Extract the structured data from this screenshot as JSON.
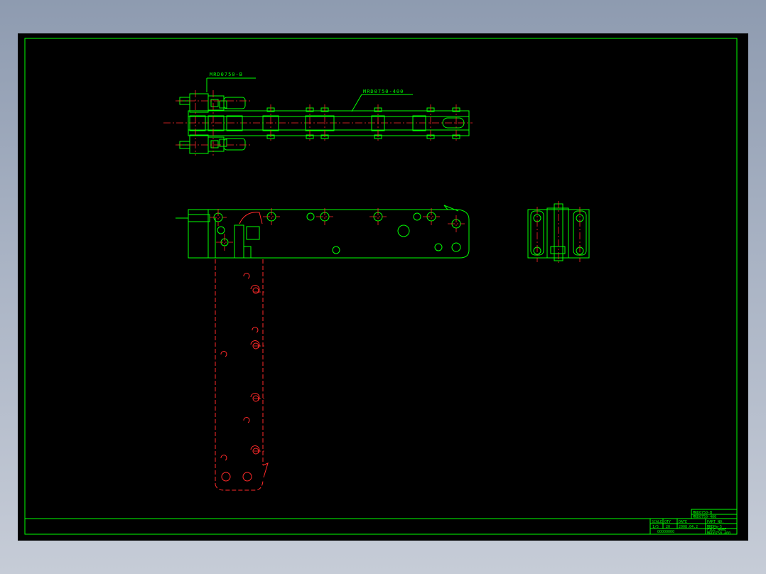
{
  "drawing": {
    "callouts": {
      "part_a": "MRD0750-B",
      "part_b": "MRD0750-400"
    },
    "title_block": {
      "title_label": "TITLE",
      "title_value": "MRD0750-B",
      "sub_value": "MRD0750-400",
      "scale_label": "SCALE",
      "scale_value": "1/5",
      "qty_label": "QTY",
      "qty_value": "20",
      "date_label": "DATE",
      "date_value": "2008.04.2",
      "part_label": "PART NO.",
      "part_value": "MRDPm-5",
      "file_label": "FILE NAME",
      "file_value": "MRD0750-400",
      "company": "OOOOOOOO"
    },
    "colors": {
      "outline": "#00ff00",
      "hidden": "#ff2a2a",
      "background": "#000000"
    }
  }
}
